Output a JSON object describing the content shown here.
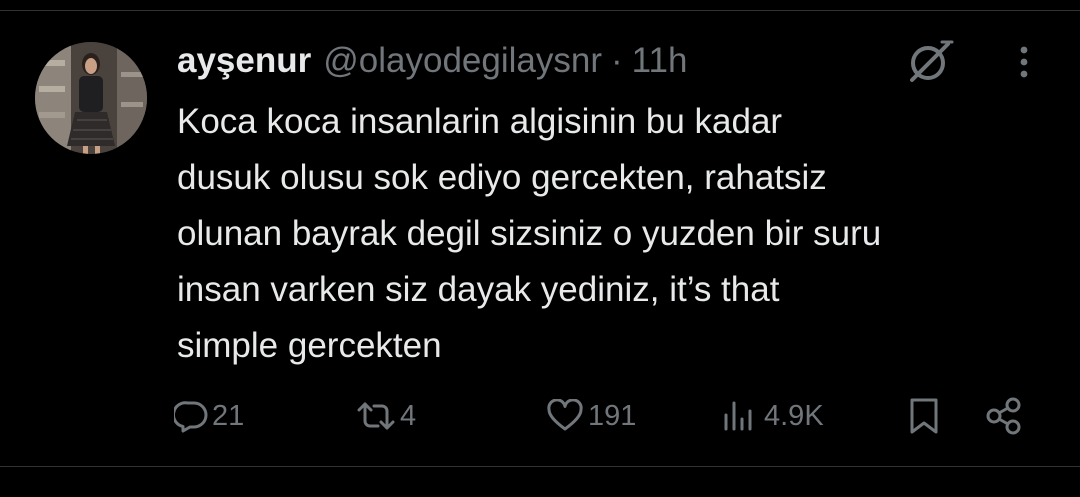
{
  "tweet": {
    "display_name": "ayşenur",
    "handle": "@olayodegilaysnr",
    "separator": "·",
    "time": "11h",
    "text": "Koca koca insanlarin algisinin bu kadar\ndusuk olusu sok ediyo gercekten, rahatsiz\nolunan bayrak degil sizsiniz o yuzden bir suru\ninsan varken siz dayak yediniz, it’s that\nsimple gercekten",
    "avatar_icon": "profile-photo",
    "grok_icon": "grok-icon",
    "more_icon": "more-vertical-icon"
  },
  "actions": {
    "replies": "21",
    "retweets": "4",
    "likes": "191",
    "views": "4.9K",
    "reply_icon": "reply-icon",
    "retweet_icon": "retweet-icon",
    "like_icon": "heart-icon",
    "views_icon": "views-chart-icon",
    "bookmark_icon": "bookmark-icon",
    "share_icon": "share-icon"
  },
  "colors": {
    "background": "#000000",
    "text_primary": "#e7e9ea",
    "text_secondary": "#71767b",
    "divider": "#2f3336"
  }
}
